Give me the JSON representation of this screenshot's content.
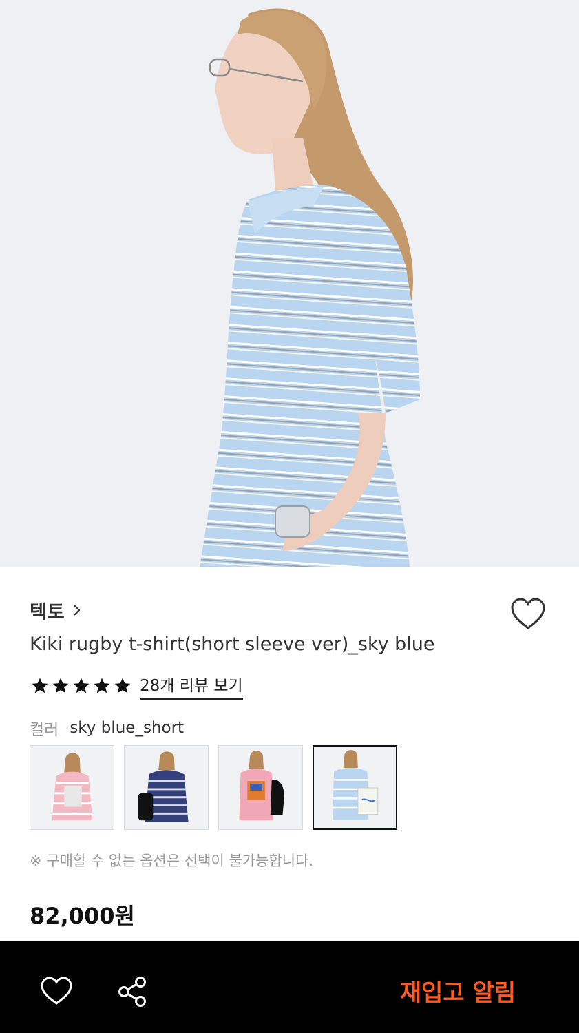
{
  "product": {
    "brand": "텍토",
    "title": "Kiki rugby t-shirt(short sleeve ver)_sky blue",
    "rating": 5,
    "review_link": "28개 리뷰 보기",
    "color_label": "컬러",
    "color_value": "sky blue_short",
    "variants": [
      {
        "name": "pink striped",
        "selected": false
      },
      {
        "name": "navy striped",
        "selected": false
      },
      {
        "name": "pink graphic",
        "selected": false
      },
      {
        "name": "sky blue_short",
        "selected": true
      }
    ],
    "note": "※ 구매할 수 없는 옵션은 선택이 불가능합니다.",
    "price": "82,000원"
  },
  "bottom_bar": {
    "restock_label": "재입고 알림"
  },
  "colors": {
    "accent": "#ff5a1f",
    "bar_bg": "#000000",
    "shirt": "#b7d3ee"
  },
  "icons": [
    "chevron-right-icon",
    "heart-icon",
    "star-icon",
    "share-icon"
  ]
}
